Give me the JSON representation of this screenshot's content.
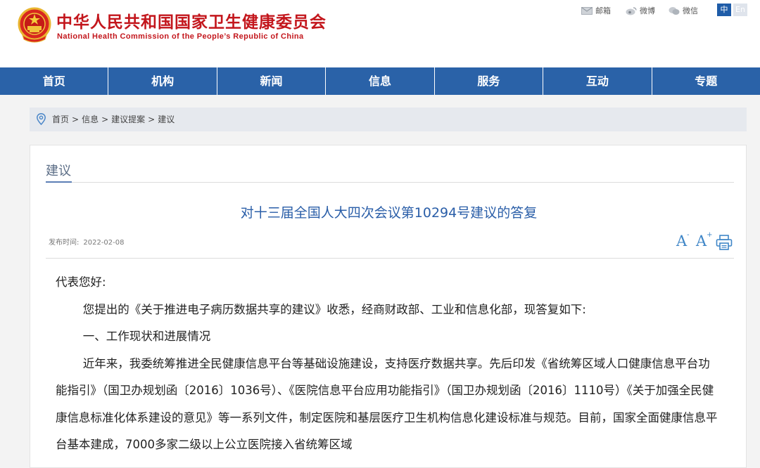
{
  "header": {
    "title_cn": "中华人民共和国国家卫生健康委员会",
    "title_en": "National Health Commission of the People’s Republic of China",
    "links": [
      {
        "label": "邮箱",
        "icon": "mail-icon"
      },
      {
        "label": "微博",
        "icon": "weibo-icon"
      },
      {
        "label": "微信",
        "icon": "wechat-icon"
      }
    ],
    "lang_zh": "中",
    "lang_en": "En",
    "emblem_icon": "national-emblem-icon",
    "brand_color": "#c3161c"
  },
  "nav": {
    "color": "#2a62a8",
    "items": [
      "首页",
      "机构",
      "新闻",
      "信息",
      "服务",
      "互动",
      "专题"
    ]
  },
  "breadcrumb": {
    "icon": "location-pin-icon",
    "items": [
      "首页",
      "信息",
      "建议提案",
      "建议"
    ],
    "separator": ">"
  },
  "section": {
    "label": "建议"
  },
  "article": {
    "title": "对十三届全国人大四次会议第10294号建议的答复",
    "date_label": "发布时间:",
    "date": "2022-02-08",
    "font_increase_label": "A",
    "font_decrease_label": "A",
    "print_icon": "print-icon",
    "paragraphs": [
      "代表您好:",
      "您提出的《关于推进电子病历数据共享的建议》收悉，经商财政部、工业和信息化部，现答复如下:",
      "一、工作现状和进展情况",
      "近年来，我委统筹推进全民健康信息平台等基础设施建设，支持医疗数据共享。先后印发《省统筹区域人口健康信息平台功能指引》（国卫办规划函〔2016〕1036号）、《医院信息平台应用功能指引》（国卫办规划函〔2016〕1110号）《关于加强全民健康信息标准化体系建设的意见》等一系列文件，制定医院和基层医疗卫生机构信息化建设标准与规范。目前，国家全面健康信息平台基本建成，7000多家二级以上公立医院接入省统筹区域"
    ]
  }
}
